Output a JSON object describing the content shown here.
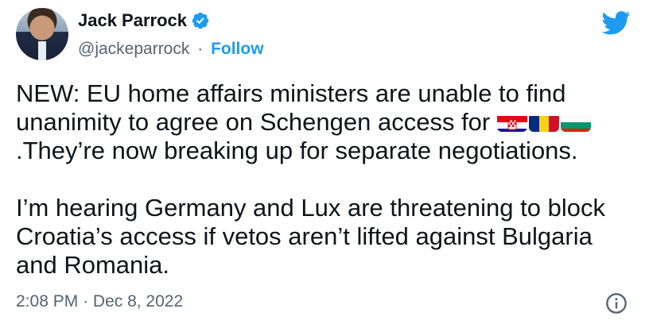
{
  "author": {
    "name": "Jack Parrock",
    "handle": "@jackeparrock",
    "separator": "·",
    "follow_label": "Follow",
    "verified": true
  },
  "tweet": {
    "line1": "NEW: EU home affairs ministers are unable to find",
    "line2_text": "unanimity to agree on Schengen access for",
    "line3": ".They’re now breaking up for separate negotiations.",
    "paragraph2": "I’m hearing Germany and Lux are threatening to block Croatia’s access if vetos aren’t lifted against Bulgaria and Romania.",
    "flags": [
      "croatia-flag",
      "romania-flag",
      "bulgaria-flag"
    ]
  },
  "meta": {
    "time": "2:08 PM",
    "separator": "·",
    "date": "Dec 8, 2022"
  },
  "icons": {
    "brand": "twitter-bird-icon",
    "info": "info-icon",
    "verified": "verified-badge-icon"
  },
  "colors": {
    "brand_blue": "#1d9bf0",
    "text": "#0f1419",
    "secondary": "#536471"
  }
}
